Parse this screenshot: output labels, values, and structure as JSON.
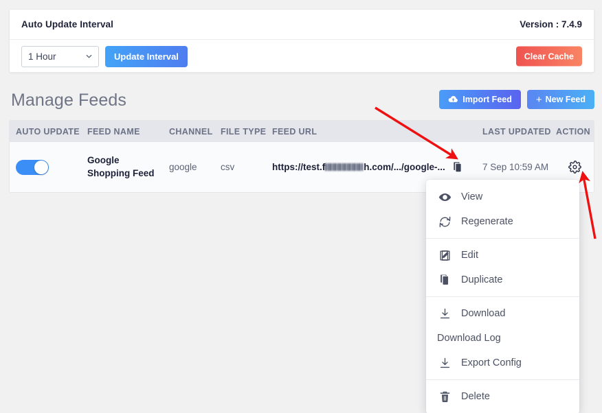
{
  "top_card": {
    "title": "Auto Update Interval",
    "version_label": "Version : 7.4.9",
    "interval_selected": "1 Hour",
    "interval_options": [
      "1 Hour"
    ],
    "update_button": "Update Interval",
    "clear_cache_button": "Clear Cache"
  },
  "section": {
    "title": "Manage Feeds",
    "import_button": "Import Feed",
    "new_button": "New Feed",
    "new_button_plus": "+"
  },
  "table": {
    "columns": {
      "auto_update": "AUTO UPDATE",
      "feed_name": "FEED NAME",
      "channel": "CHANNEL",
      "file_type": "FILE TYPE",
      "feed_url": "FEED URL",
      "last_updated": "LAST UPDATED",
      "action": "ACTION"
    },
    "rows": [
      {
        "auto_update_on": true,
        "feed_name": "Google Shopping Feed",
        "channel": "google",
        "file_type": "csv",
        "url_prefix": "https://test.f",
        "url_suffix": "h.com/.../google-...",
        "last_updated": "7 Sep 10:59 AM"
      }
    ]
  },
  "menu": {
    "items": [
      {
        "label": "View",
        "icon": "eye-icon"
      },
      {
        "label": "Regenerate",
        "icon": "refresh-icon"
      },
      {
        "label": "Edit",
        "icon": "edit-icon"
      },
      {
        "label": "Duplicate",
        "icon": "duplicate-icon"
      },
      {
        "label": "Download",
        "icon": "download-icon"
      },
      {
        "label": "Download Log",
        "icon": "none"
      },
      {
        "label": "Export Config",
        "icon": "download-icon"
      },
      {
        "label": "Delete",
        "icon": "trash-icon"
      }
    ]
  },
  "colors": {
    "accent_blue": "#3b8ef5",
    "danger_red": "#ef5350",
    "arrow_red": "#ee1111",
    "page_bg": "#f1f1f1",
    "thead_bg": "#e4e6ec"
  }
}
